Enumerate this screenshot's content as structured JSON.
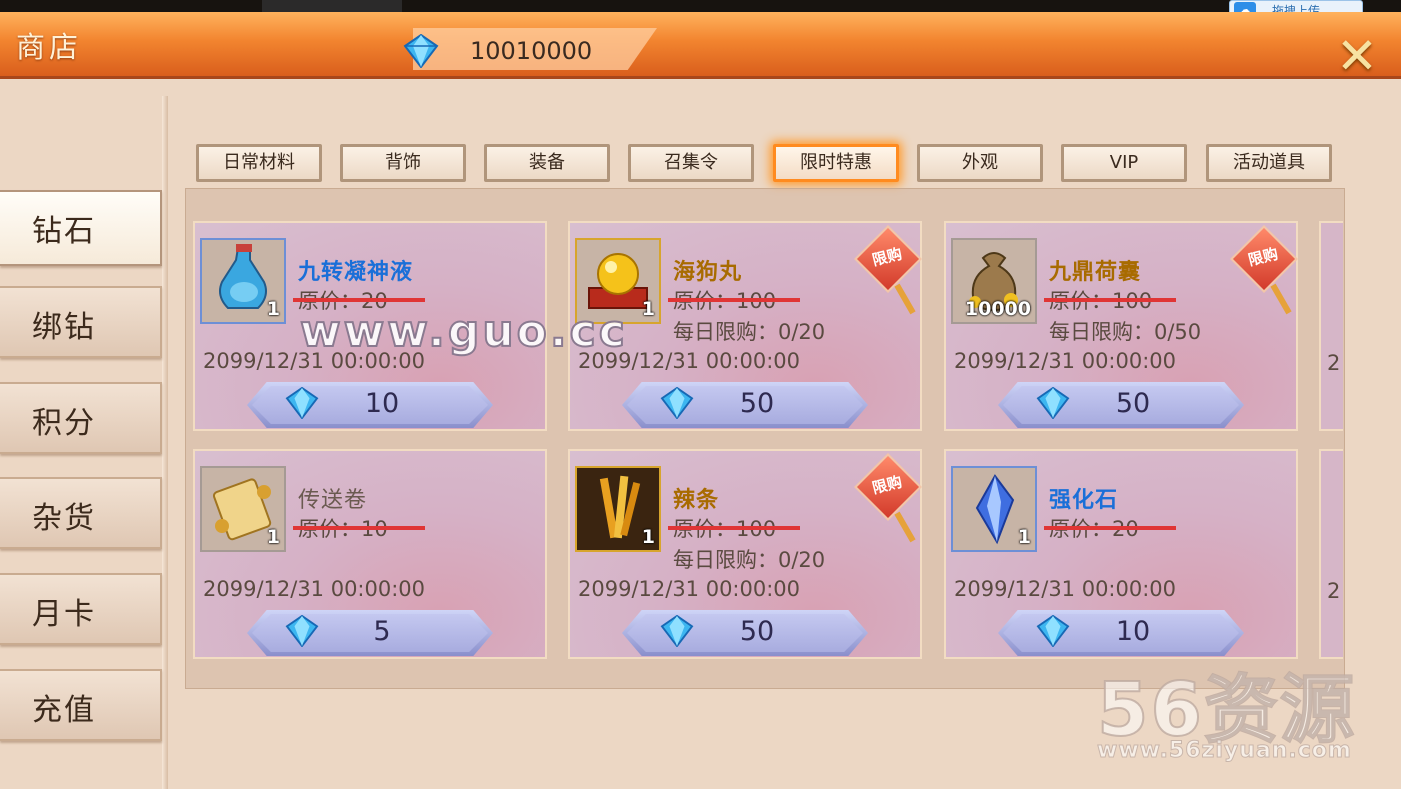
{
  "header": {
    "title": "商店",
    "currency_value": "10010000"
  },
  "upload_button": {
    "label": "拖拽上传"
  },
  "sidebar": {
    "items": [
      {
        "label": "钻石",
        "active": true
      },
      {
        "label": "绑钻"
      },
      {
        "label": "积分"
      },
      {
        "label": "杂货"
      },
      {
        "label": "月卡"
      },
      {
        "label": "充值"
      }
    ]
  },
  "tabs": [
    {
      "label": "日常材料"
    },
    {
      "label": "背饰"
    },
    {
      "label": "装备"
    },
    {
      "label": "召集令"
    },
    {
      "label": "限时特惠",
      "active": true
    },
    {
      "label": "外观"
    },
    {
      "label": "VIP"
    },
    {
      "label": "活动道具"
    }
  ],
  "items": [
    {
      "name": "九转凝神液",
      "name_color": "#1a6fd8",
      "qty": "1",
      "original_price": "原价：20",
      "daily_limit": "",
      "date": "2099/12/31 00:00:00",
      "price": "10",
      "limited": false,
      "icon": "potion-icon"
    },
    {
      "name": "海狗丸",
      "name_color": "#a86b00",
      "qty": "1",
      "original_price": "原价：100",
      "daily_limit": "每日限购：0/20",
      "date": "2099/12/31 00:00:00",
      "price": "50",
      "limited": true,
      "limited_label": "限购",
      "icon": "golden-pill-icon"
    },
    {
      "name": "九鼎荷囊",
      "name_color": "#a86b00",
      "qty": "10000",
      "original_price": "原价：100",
      "daily_limit": "每日限购：0/50",
      "date": "2099/12/31 00:00:00",
      "price": "50",
      "limited": true,
      "limited_label": "限购",
      "icon": "money-bag-icon"
    },
    {
      "name": "传送卷",
      "name_color": "#6a5a50",
      "qty": "1",
      "original_price": "原价：10",
      "daily_limit": "",
      "date": "2099/12/31 00:00:00",
      "price": "5",
      "limited": false,
      "icon": "scroll-icon"
    },
    {
      "name": "辣条",
      "name_color": "#a86b00",
      "qty": "1",
      "original_price": "原价：100",
      "daily_limit": "每日限购：0/20",
      "date": "2099/12/31 00:00:00",
      "price": "50",
      "limited": true,
      "limited_label": "限购",
      "icon": "spicy-strip-icon"
    },
    {
      "name": "强化石",
      "name_color": "#1a6fd8",
      "qty": "1",
      "original_price": "原价：20",
      "daily_limit": "",
      "date": "2099/12/31 00:00:00",
      "price": "10",
      "limited": false,
      "icon": "crystal-icon"
    }
  ],
  "edge_cards": [
    {
      "date_fragment": "2"
    },
    {
      "date_fragment": "2"
    }
  ],
  "watermarks": {
    "center": "www.guo.cc",
    "brand": "56资源",
    "url": "www.56ziyuan.com"
  },
  "colors": {
    "accent": "#ff8b1f",
    "header": "#f2842f",
    "strike": "#e03535"
  }
}
